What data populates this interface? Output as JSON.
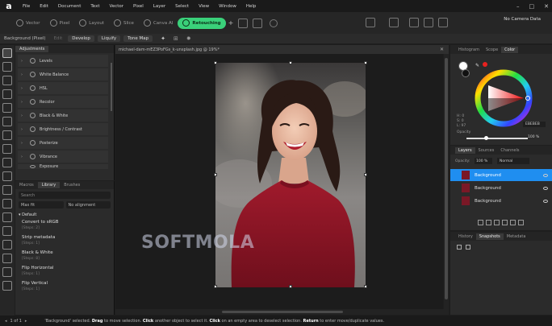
{
  "app": {
    "menu": [
      "File",
      "Edit",
      "Document",
      "Text",
      "Vector",
      "Pixel",
      "Layer",
      "Select",
      "View",
      "Window",
      "Help"
    ],
    "personas": [
      "Vector",
      "Pixel",
      "Layout",
      "Slice",
      "Canva AI",
      "Retouching"
    ],
    "camera_status": "No Camera Data"
  },
  "context_bar": {
    "layer_type": "Background (Pixel)",
    "edit_label": "Edit",
    "develop_label": "Develop",
    "liquify_label": "Liquify",
    "tone_map_label": "Tone Map"
  },
  "adjustments": {
    "tabs": [
      "Adjustments"
    ],
    "items": [
      "Levels",
      "White Balance",
      "HSL",
      "Recolor",
      "Black & White",
      "Brightness / Contrast",
      "Posterize",
      "Vibrance",
      "Exposure"
    ]
  },
  "macros": {
    "tabs": [
      "Macros",
      "Library",
      "Brushes"
    ],
    "search_placeholder": "Search",
    "fit_select": "Max fit",
    "alignment_select": "No alignment",
    "group_name": "Default",
    "items": [
      {
        "name": "Convert to sRGB",
        "steps": "[Steps: 2]"
      },
      {
        "name": "Strip metadata",
        "steps": "[Steps: 1]"
      },
      {
        "name": "Black & White",
        "steps": "[Steps: 8]"
      },
      {
        "name": "Flip Horizontal",
        "steps": "[Steps: 1]"
      },
      {
        "name": "Flip Vertical",
        "steps": "[Steps: 1]"
      }
    ]
  },
  "document": {
    "tab_title": "michael-dam-mEZ3PoFGs_k-unsplash.jpg @ 19%*"
  },
  "color_panel": {
    "tabs": [
      "Histogram",
      "Scope",
      "Color"
    ],
    "h_label": "H: 0",
    "s_label": "S: 0",
    "l_label": "L: 97",
    "hex_value": "EBEBEB",
    "opacity_label": "Opacity",
    "opacity_value": "100 %"
  },
  "layers_panel": {
    "tabs": [
      "Layers",
      "Sources",
      "Channels"
    ],
    "opacity_label": "Opacity:",
    "opacity_value": "100 %",
    "blend_mode": "Normal",
    "layers": [
      "Background",
      "Background",
      "Background"
    ]
  },
  "history_panel": {
    "tabs": [
      "History",
      "Snapshots",
      "Metadata"
    ]
  },
  "status": {
    "pages": "1 of 1",
    "message_parts": [
      "'Background' selected. ",
      "Drag",
      " to move selection. ",
      "Click",
      " another object to select it. ",
      "Click",
      " on an empty area to deselect selection. ",
      "Return",
      " to enter move/duplicate values."
    ]
  },
  "watermark": "SOFTMOLA",
  "colors": {
    "accent": "#1f8ef0",
    "persona_active": "#3ad17a",
    "shirt": "#8b1525"
  }
}
